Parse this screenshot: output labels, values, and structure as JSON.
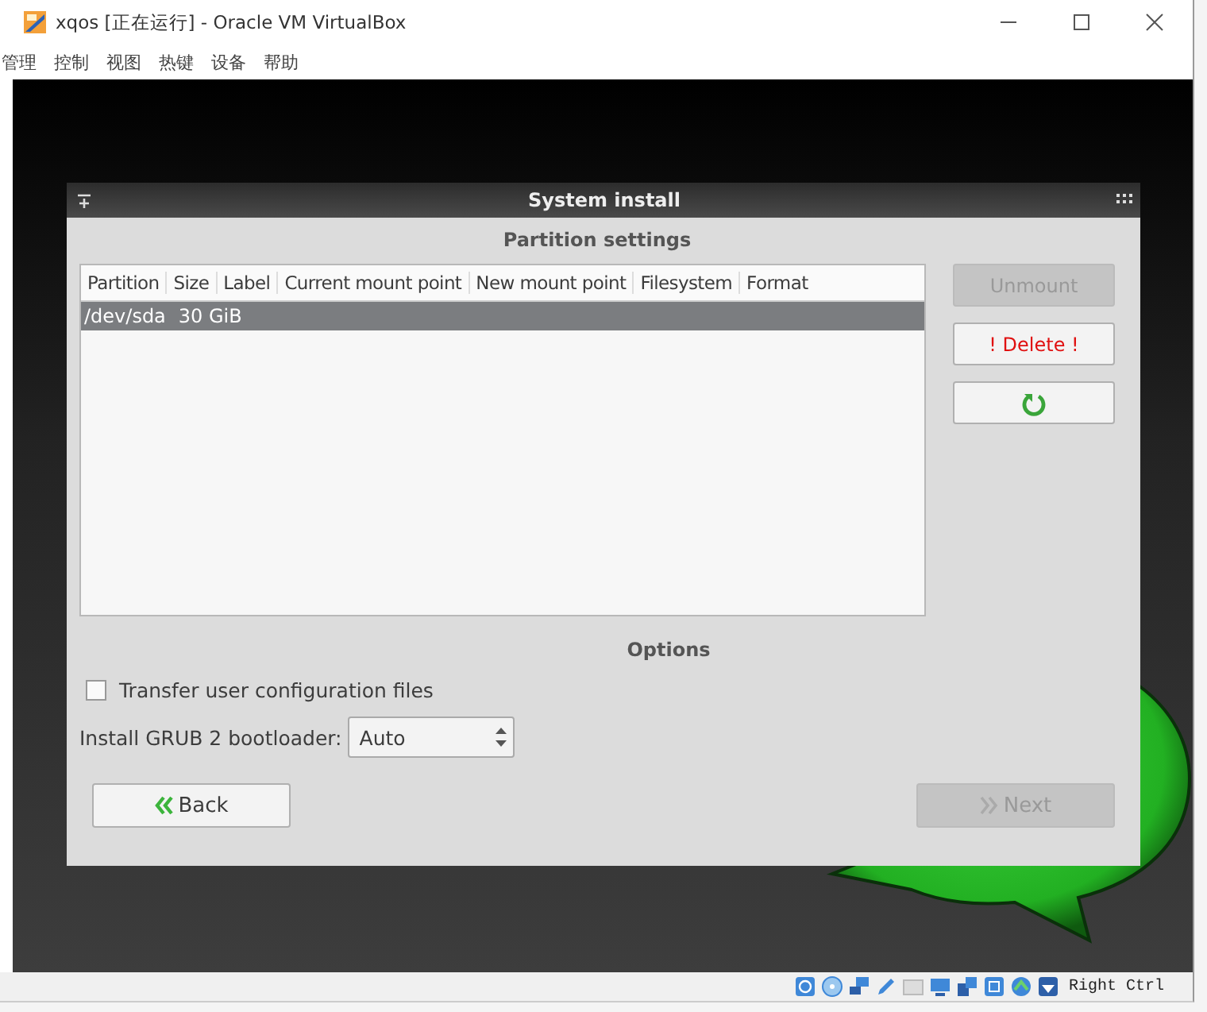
{
  "window": {
    "title": "xqos [正在运行] - Oracle VM VirtualBox"
  },
  "menu": [
    "管理",
    "控制",
    "视图",
    "热键",
    "设备",
    "帮助"
  ],
  "dialog": {
    "title": "System install",
    "section_title": "Partition settings",
    "table": {
      "columns": [
        "Partition",
        "Size",
        "Label",
        "Current mount point",
        "New mount point",
        "Filesystem",
        "Format"
      ],
      "rows": [
        {
          "cells": [
            "/dev/sda",
            "30 GiB"
          ],
          "selected": true
        }
      ]
    },
    "side_buttons": [
      {
        "kind": "text",
        "label": "Unmount",
        "disabled": true
      },
      {
        "kind": "danger",
        "label": "! Delete !",
        "disabled": false
      },
      {
        "kind": "refresh",
        "disabled": false
      }
    ],
    "options_title": "Options",
    "transfer_config": {
      "label": "Transfer user configuration files",
      "checked": false
    },
    "grub": {
      "label": "Install GRUB 2 bootloader:",
      "value": "Auto"
    },
    "back": {
      "label": "Back",
      "disabled": false
    },
    "next": {
      "label": "Next",
      "disabled": true
    }
  },
  "status_bar": {
    "host_key": "Right Ctrl"
  }
}
